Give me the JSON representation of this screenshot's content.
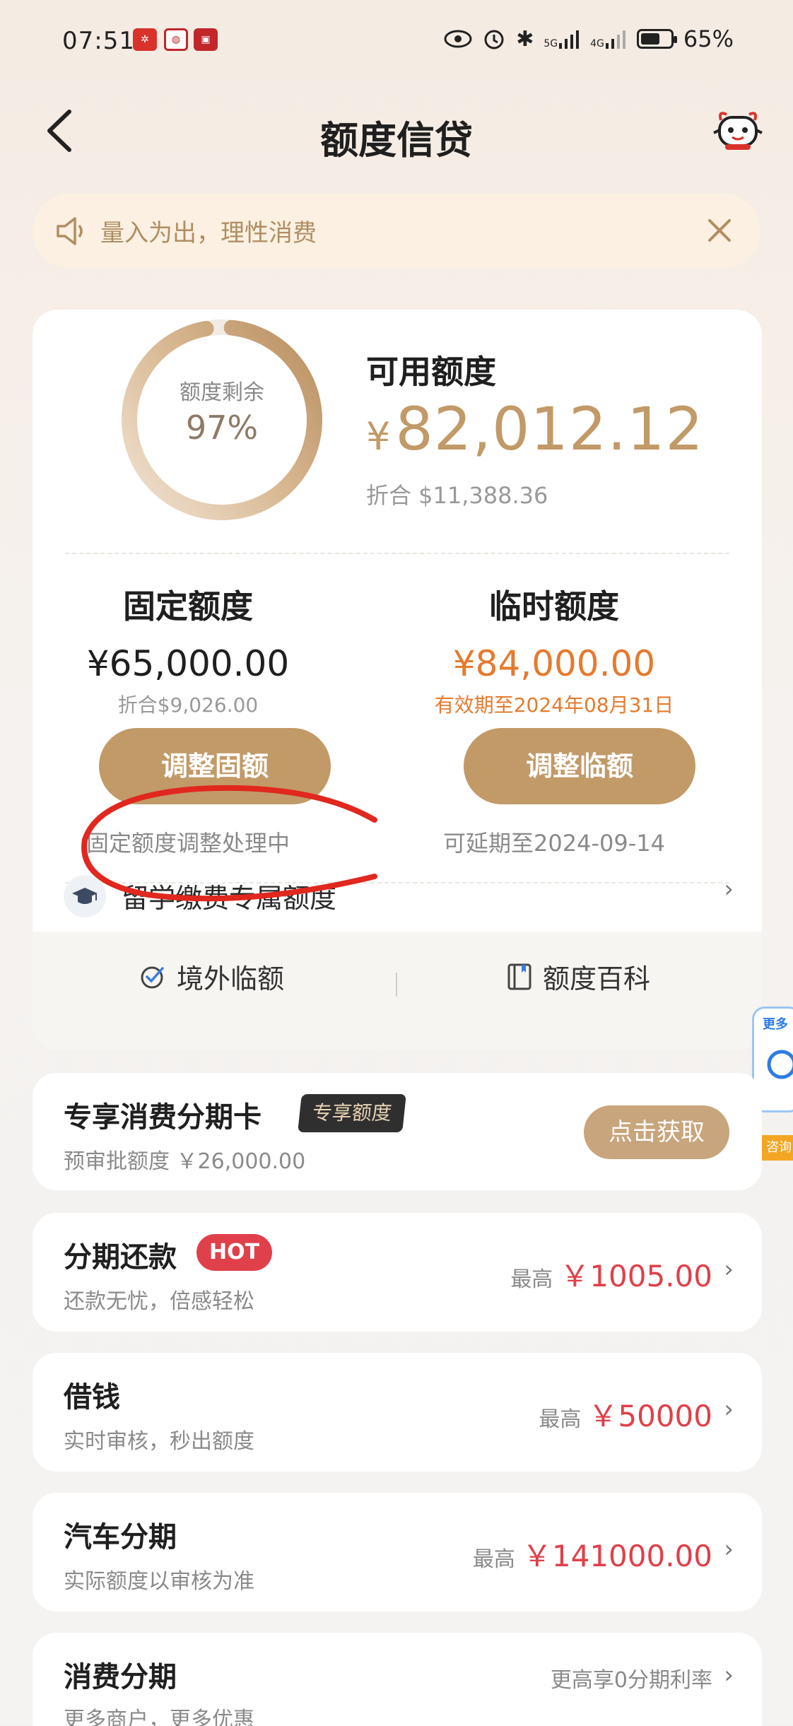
{
  "status_bar": {
    "time": "07:51",
    "network_5g": "5G",
    "network_4g": "4G",
    "battery": "65%",
    "battery_level": 0.65
  },
  "header": {
    "title": "额度信贷"
  },
  "notice": {
    "text": "量入为出，理性消费"
  },
  "credit": {
    "ring_label": "额度剩余",
    "ring_percent": "97%",
    "ring_fraction": 0.97,
    "available_label": "可用额度",
    "currency": "¥",
    "available_amount": "82,012.12",
    "available_usd": "折合  $11,388.36",
    "fixed": {
      "title": "固定额度",
      "amount": "¥65,000.00",
      "sub": "折合$9,026.00",
      "button": "调整固额",
      "note": "固定额度调整处理中"
    },
    "temp": {
      "title": "临时额度",
      "amount": "¥84,000.00",
      "sub": "有效期至2024年08月31日",
      "button": "调整临额",
      "note": "可延期至2024-09-14"
    },
    "study_label": "留学缴费专属额度",
    "overseas_label": "境外临额",
    "wiki_label": "额度百科"
  },
  "side_widget": {
    "more": "更多",
    "tag": "咨询"
  },
  "cards": {
    "installment_card": {
      "title": "专享消费分期卡",
      "badge": "专享额度",
      "desc": "预审批额度 ￥26,000.00",
      "button": "点击获取"
    },
    "repay": {
      "title": "分期还款",
      "badge": "HOT",
      "desc": "还款无忧，倍感轻松",
      "prefix": "最高",
      "amount": "￥1005.00"
    },
    "borrow": {
      "title": "借钱",
      "desc": "实时审核，秒出额度",
      "prefix": "最高",
      "amount": "￥50000"
    },
    "car": {
      "title": "汽车分期",
      "desc": "实际额度以审核为准",
      "prefix": "最高",
      "amount": "￥141000.00"
    },
    "consume": {
      "title": "消费分期",
      "desc": "更多商户，更多优惠",
      "right": "更高享0分期利率"
    }
  },
  "colors": {
    "gold": "#c19a68",
    "orange": "#e57a2e",
    "red": "#e0404a",
    "annotation": "#e0281e"
  }
}
